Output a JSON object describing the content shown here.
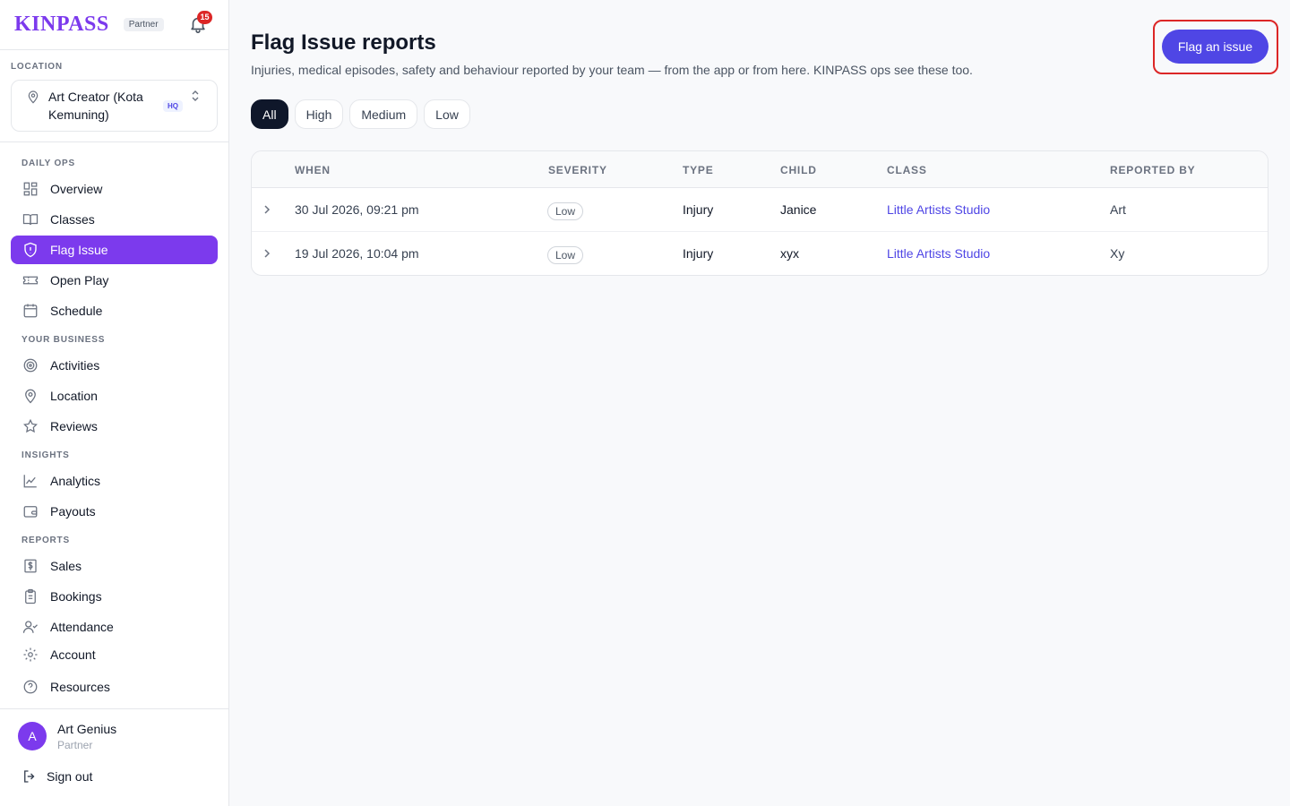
{
  "brand": {
    "name": "KINPASS",
    "tag": "Partner",
    "notifications": "15"
  },
  "location": {
    "label": "LOCATION",
    "name": "Art Creator (Kota Kemuning)",
    "badge": "HQ"
  },
  "nav": {
    "sections": {
      "daily_ops": "DAILY OPS",
      "your_business": "YOUR BUSINESS",
      "insights": "INSIGHTS",
      "reports": "REPORTS"
    },
    "items": {
      "overview": "Overview",
      "classes": "Classes",
      "flag_issue": "Flag Issue",
      "open_play": "Open Play",
      "schedule": "Schedule",
      "activities": "Activities",
      "location": "Location",
      "reviews": "Reviews",
      "analytics": "Analytics",
      "payouts": "Payouts",
      "sales": "Sales",
      "bookings": "Bookings",
      "attendance": "Attendance",
      "account": "Account",
      "resources": "Resources"
    }
  },
  "user": {
    "initial": "A",
    "name": "Art Genius",
    "role": "Partner",
    "signout": "Sign out"
  },
  "page": {
    "title": "Flag Issue reports",
    "subtitle": "Injuries, medical episodes, safety and behaviour reported by your team — from the app or from here. KINPASS ops see these too.",
    "primary_action": "Flag an issue"
  },
  "filters": [
    "All",
    "High",
    "Medium",
    "Low"
  ],
  "table": {
    "headers": {
      "when": "WHEN",
      "severity": "SEVERITY",
      "type": "TYPE",
      "child": "CHILD",
      "class": "CLASS",
      "reported_by": "REPORTED BY"
    },
    "rows": [
      {
        "when": "30 Jul 2026, 09:21 pm",
        "severity": "Low",
        "type": "Injury",
        "child": "Janice",
        "class": "Little Artists Studio",
        "reported_by": "Art"
      },
      {
        "when": "19 Jul 2026, 10:04 pm",
        "severity": "Low",
        "type": "Injury",
        "child": "xyx",
        "class": "Little Artists Studio",
        "reported_by": "Xy"
      }
    ]
  },
  "colors": {
    "accent": "#7c3aed",
    "primary_button": "#4f46e5",
    "link": "#4f46e5",
    "badge": "#dc2626"
  }
}
